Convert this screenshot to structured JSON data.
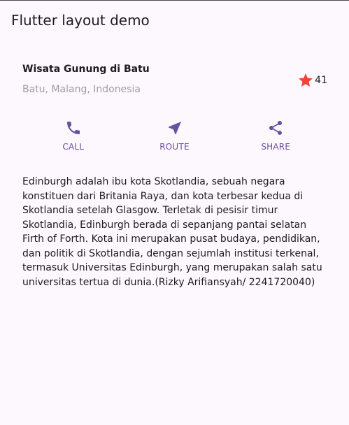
{
  "app_bar": {
    "title": "Flutter layout demo"
  },
  "title_section": {
    "name": "Wisata Gunung di Batu",
    "location": "Batu, Malang, Indonesia",
    "rating": {
      "icon": "star-icon",
      "count": "41",
      "star_color": "#f44336"
    }
  },
  "buttons": [
    {
      "icon": "call-icon",
      "label": "CALL"
    },
    {
      "icon": "near-me-icon",
      "label": "ROUTE"
    },
    {
      "icon": "share-icon",
      "label": "SHARE"
    }
  ],
  "accent_color": "#67509f",
  "description": "Edinburgh adalah ibu kota Skotlandia, sebuah negara konstituen dari Britania Raya, dan kota terbesar kedua di Skotlandia setelah Glasgow. Terletak di pesisir timur Skotlandia, Edinburgh berada di sepanjang pantai selatan Firth of Forth. Kota ini merupakan pusat budaya, pendidikan, dan politik di Skotlandia, dengan sejumlah institusi terkenal, termasuk Universitas Edinburgh, yang merupakan salah satu universitas tertua di dunia.(Rizky Arifiansyah/ 2241720040)"
}
